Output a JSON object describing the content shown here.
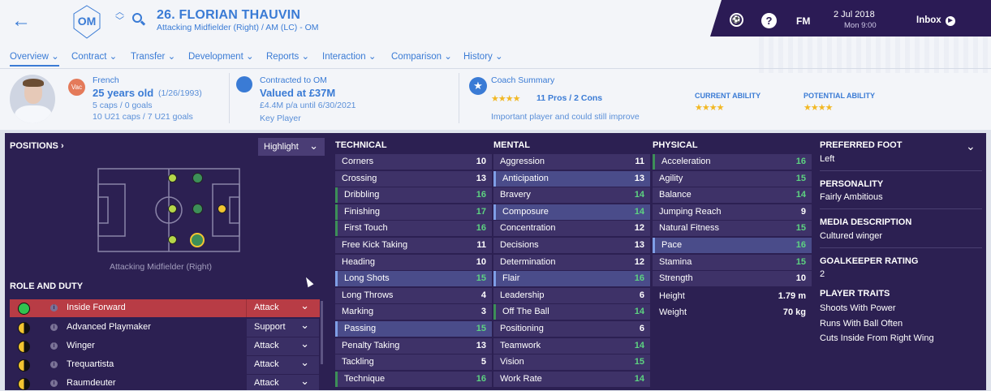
{
  "header": {
    "player_name": "26. FLORIAN THAUVIN",
    "position_line": "Attacking Midfielder (Right) / AM (LC) - OM",
    "date": "2 Jul 2018",
    "time": "Mon 9:00",
    "fm_label": "FM",
    "inbox_label": "Inbox",
    "help_label": "?"
  },
  "nav": [
    "Overview",
    "Contract",
    "Transfer",
    "Development",
    "Reports",
    "Interaction",
    "Comparison",
    "History"
  ],
  "info": {
    "vac_badge": "Vac",
    "nationality": "French",
    "age": "25 years old",
    "dob": "(1/26/1993)",
    "caps": "5 caps / 0 goals",
    "u21": "10 U21 caps / 7 U21 goals",
    "contracted_label": "Contracted to OM",
    "value": "Valued at £37M",
    "wage": "£4.4M p/a until 6/30/2021",
    "status": "Key Player",
    "coach_summary_label": "Coach Summary",
    "coach_stars": "★★★★",
    "pros_cons": "11 Pros / 2 Cons",
    "coach_note": "Important player and could still improve",
    "current_ability_label": "CURRENT ABILITY",
    "current_ability_stars": "★★★★",
    "potential_ability_label": "POTENTIAL ABILITY",
    "potential_ability_stars": "★★★★"
  },
  "positions": {
    "title": "POSITIONS",
    "highlight": "Highlight",
    "position_caption": "Attacking Midfielder (Right)",
    "role_title": "ROLE AND DUTY"
  },
  "roles": [
    {
      "name": "Inside Forward",
      "duty": "Attack"
    },
    {
      "name": "Advanced Playmaker",
      "duty": "Support"
    },
    {
      "name": "Winger",
      "duty": "Attack"
    },
    {
      "name": "Trequartista",
      "duty": "Attack"
    },
    {
      "name": "Raumdeuter",
      "duty": "Attack"
    }
  ],
  "technical_title": "TECHNICAL",
  "technical": [
    {
      "name": "Corners",
      "value": "10"
    },
    {
      "name": "Crossing",
      "value": "13"
    },
    {
      "name": "Dribbling",
      "value": "16"
    },
    {
      "name": "Finishing",
      "value": "17"
    },
    {
      "name": "First Touch",
      "value": "16"
    },
    {
      "name": "Free Kick Taking",
      "value": "11"
    },
    {
      "name": "Heading",
      "value": "10"
    },
    {
      "name": "Long Shots",
      "value": "15"
    },
    {
      "name": "Long Throws",
      "value": "4"
    },
    {
      "name": "Marking",
      "value": "3"
    },
    {
      "name": "Passing",
      "value": "15"
    },
    {
      "name": "Penalty Taking",
      "value": "13"
    },
    {
      "name": "Tackling",
      "value": "5"
    },
    {
      "name": "Technique",
      "value": "16"
    }
  ],
  "mental_title": "MENTAL",
  "mental": [
    {
      "name": "Aggression",
      "value": "11"
    },
    {
      "name": "Anticipation",
      "value": "13"
    },
    {
      "name": "Bravery",
      "value": "14"
    },
    {
      "name": "Composure",
      "value": "14"
    },
    {
      "name": "Concentration",
      "value": "12"
    },
    {
      "name": "Decisions",
      "value": "13"
    },
    {
      "name": "Determination",
      "value": "12"
    },
    {
      "name": "Flair",
      "value": "16"
    },
    {
      "name": "Leadership",
      "value": "6"
    },
    {
      "name": "Off The Ball",
      "value": "14"
    },
    {
      "name": "Positioning",
      "value": "6"
    },
    {
      "name": "Teamwork",
      "value": "14"
    },
    {
      "name": "Vision",
      "value": "15"
    },
    {
      "name": "Work Rate",
      "value": "14"
    }
  ],
  "physical_title": "PHYSICAL",
  "physical": [
    {
      "name": "Acceleration",
      "value": "16"
    },
    {
      "name": "Agility",
      "value": "15"
    },
    {
      "name": "Balance",
      "value": "14"
    },
    {
      "name": "Jumping Reach",
      "value": "9"
    },
    {
      "name": "Natural Fitness",
      "value": "15"
    },
    {
      "name": "Pace",
      "value": "16"
    },
    {
      "name": "Stamina",
      "value": "15"
    },
    {
      "name": "Strength",
      "value": "10"
    }
  ],
  "body": {
    "height_label": "Height",
    "height": "1.79 m",
    "weight_label": "Weight",
    "weight": "70 kg"
  },
  "side": {
    "foot_label": "PREFERRED FOOT",
    "foot": "Left",
    "personality_label": "PERSONALITY",
    "personality": "Fairly Ambitious",
    "media_label": "MEDIA DESCRIPTION",
    "media": "Cultured winger",
    "gk_label": "GOALKEEPER RATING",
    "gk": "2",
    "traits_label": "PLAYER TRAITS",
    "traits": [
      "Shoots With Power",
      "Runs With Ball Often",
      "Cuts Inside From Right Wing"
    ]
  },
  "colors": {
    "accent": "#3a7bd5",
    "panel": "#2c2052",
    "green_value": "#5dd381",
    "stars": "#f2b824"
  }
}
